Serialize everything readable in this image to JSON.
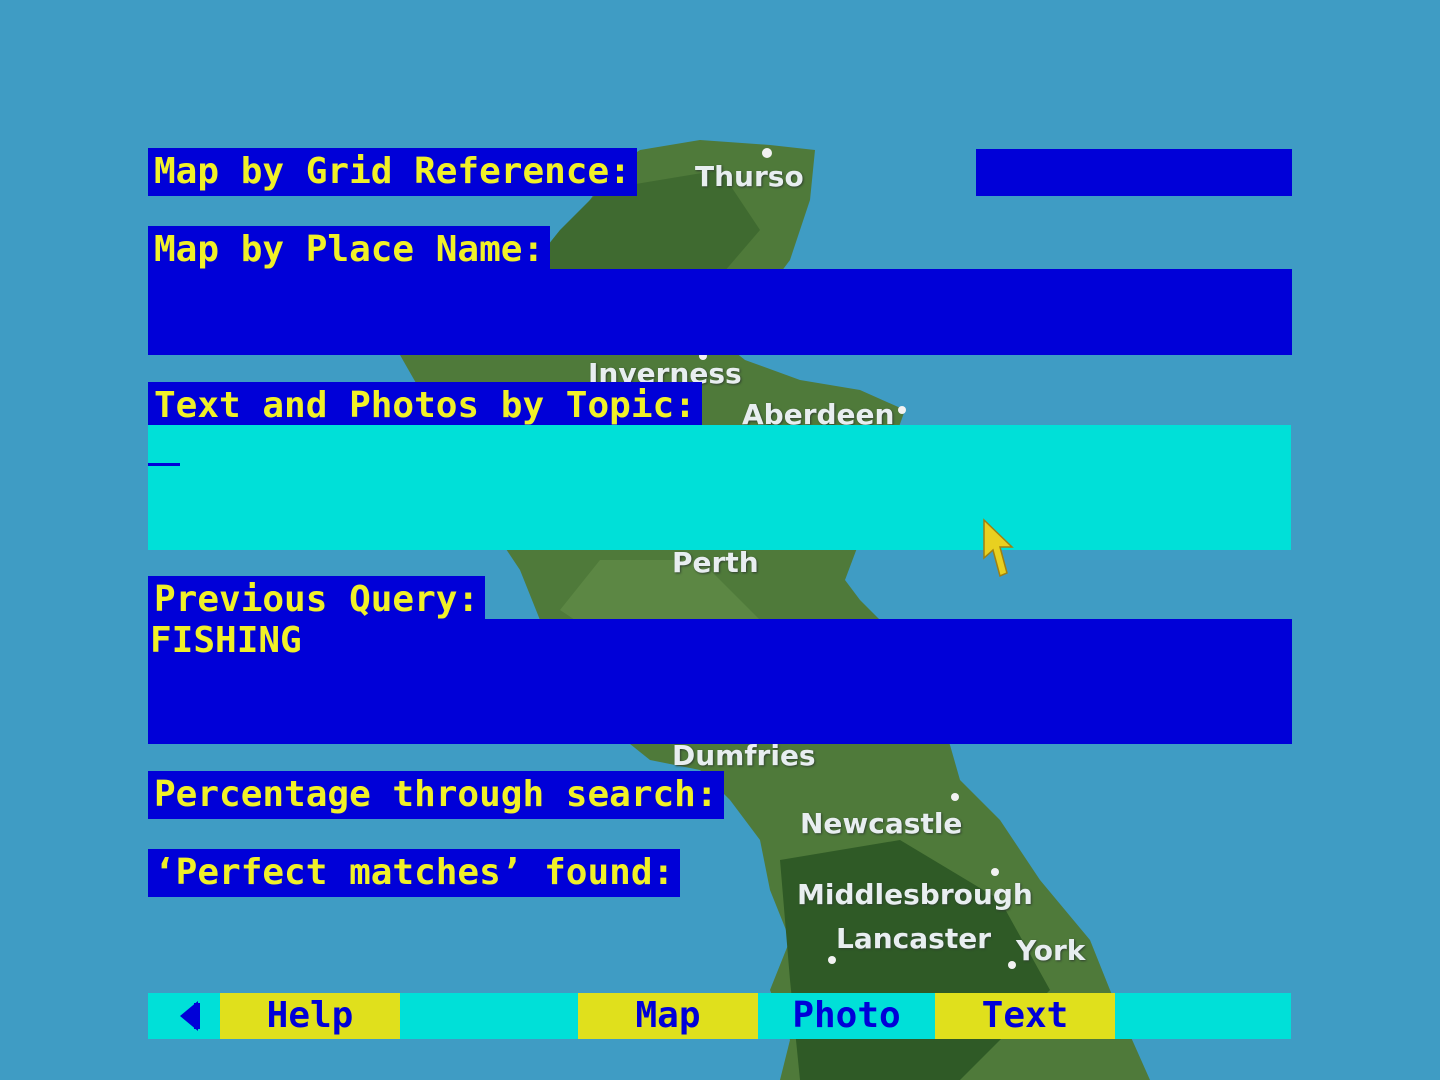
{
  "map_places": [
    "Thurso",
    "Inverness",
    "Aberdeen",
    "Perth",
    "Dumfries",
    "Newcastle",
    "Middlesbrough",
    "Lancaster",
    "York"
  ],
  "form": {
    "grid_reference": {
      "label": "Map by Grid Reference:",
      "value": ""
    },
    "place_name": {
      "label": "Map by Place Name:",
      "value": ""
    },
    "topic": {
      "label": "Text and Photos by Topic:",
      "value": ""
    },
    "previous_query": {
      "label": "Previous Query:",
      "value": "FISHING"
    },
    "percentage": {
      "label": "Percentage through search:"
    },
    "perfect_matches": {
      "label": "‘Perfect matches’ found:"
    }
  },
  "menu": {
    "back_icon": "left-arrow-icon",
    "help": "Help",
    "map": "Map",
    "photo": "Photo",
    "text": "Text"
  },
  "colors": {
    "sea": "#3f9cc4",
    "panel_blue": "#0000d8",
    "label_yellow": "#f0f028",
    "active_cyan": "#00e0d8",
    "button_yellow": "#e0e01c"
  }
}
